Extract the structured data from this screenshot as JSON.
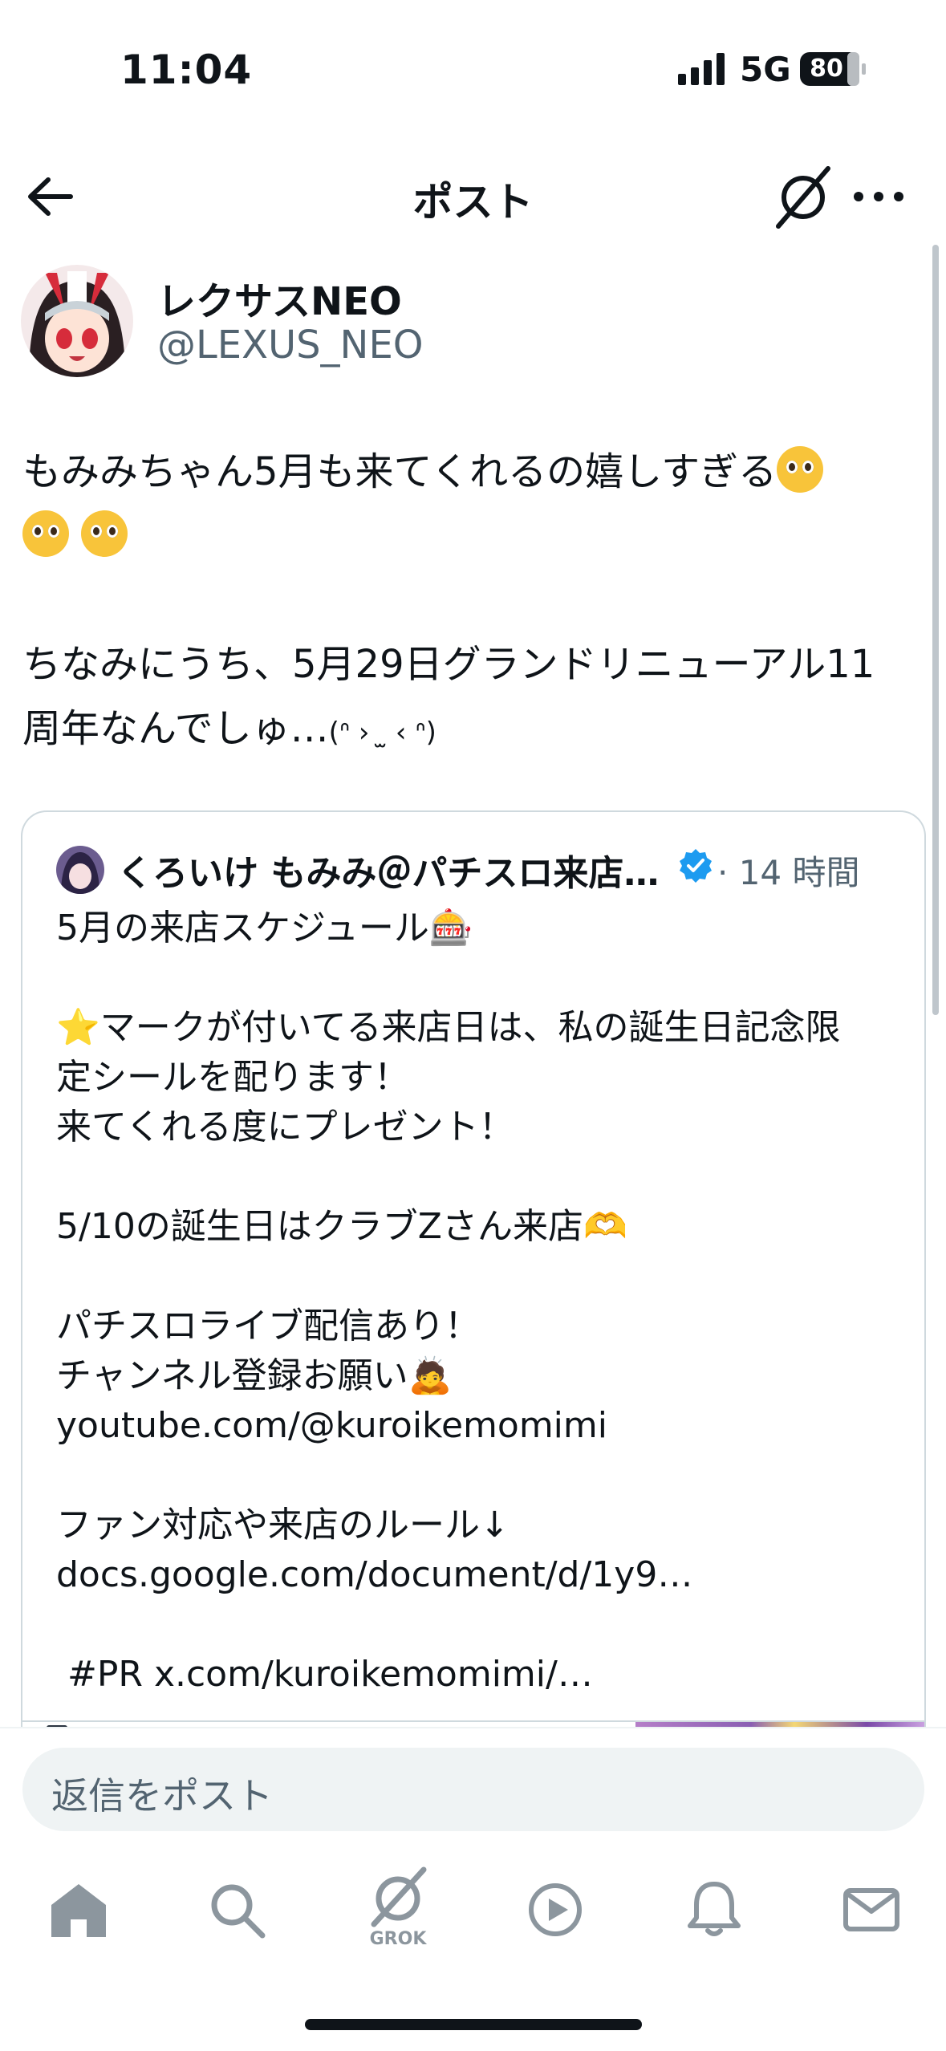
{
  "status_bar": {
    "time": "11:04",
    "network": "5G",
    "battery": "80"
  },
  "header": {
    "title": "ポスト"
  },
  "author": {
    "display_name": "レクサスNEO",
    "handle": "@LEXUS_NEO"
  },
  "tweet": {
    "line1": "もみみちゃん5月も来てくれるの嬉しすぎる",
    "line3": "ちなみにうち、5月29日グランドリニューアル11",
    "line4": "周年なんでしゅ…",
    "kaomoji": "(ᐢ ›  ̫ ‹ ᐢ)"
  },
  "quote": {
    "name": "くろいけ もみみ＠パチスロ来店…",
    "time": "· 14 時間",
    "text": "5月の来店スケジュール🎰\n\n⭐マークが付いてる来店日は、私の誕生日記念限\n定シールを配ります！\n来てくれる度にプレゼント！\n\n5/10の誕生日はクラブZさん来店🫶\n\nパチスロライブ配信あり！\nチャンネル登録お願い🙇\nyoutube.com/@kuroikemomimi\n\nファン対応や来店のルール↓\ndocs.google.com/document/d/1y9…\n\n #PR x.com/kuroikemomimi/…"
  },
  "reply": {
    "placeholder": "返信をポスト"
  },
  "nav": {
    "grok_label": "GROK"
  },
  "colors": {
    "accent": "#1d9bf0",
    "text": "#0f1419",
    "muted": "#536471",
    "nav_icon": "#8c969e"
  },
  "icons": [
    "back-arrow-icon",
    "grok-icon",
    "more-icon",
    "verified-icon",
    "home-icon",
    "search-icon",
    "play-icon",
    "bell-icon",
    "mail-icon"
  ]
}
